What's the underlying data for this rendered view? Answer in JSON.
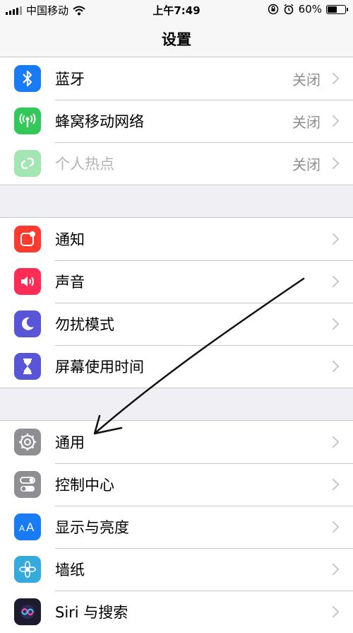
{
  "status": {
    "carrier": "中国移动",
    "time": "上午7:49",
    "battery_percent": "60%",
    "battery_level": 0.6
  },
  "nav": {
    "title": "设置"
  },
  "groups": [
    {
      "items": [
        {
          "label": "蓝牙",
          "value": "关闭",
          "icon": "bluetooth-icon",
          "color": "#1a7cf4"
        },
        {
          "label": "蜂窝移动网络",
          "value": "关闭",
          "icon": "cellular-icon",
          "color": "#34c759"
        },
        {
          "label": "个人热点",
          "value": "关闭",
          "icon": "hotspot-icon",
          "color": "#34c759",
          "disabled": true
        }
      ]
    },
    {
      "items": [
        {
          "label": "通知",
          "icon": "notifications-icon",
          "color": "#ff3b30"
        },
        {
          "label": "声音",
          "icon": "sound-icon",
          "color": "#ff2d55"
        },
        {
          "label": "勿扰模式",
          "icon": "moon-icon",
          "color": "#5856d6"
        },
        {
          "label": "屏幕使用时间",
          "icon": "hourglass-icon",
          "color": "#5856d6"
        }
      ]
    },
    {
      "items": [
        {
          "label": "通用",
          "icon": "gear-icon",
          "color": "#8e8e93"
        },
        {
          "label": "控制中心",
          "icon": "toggles-icon",
          "color": "#8e8e93"
        },
        {
          "label": "显示与亮度",
          "icon": "display-icon",
          "color": "#1a7cf4"
        },
        {
          "label": "墙纸",
          "icon": "wallpaper-flower-icon",
          "color": "#35aadc"
        },
        {
          "label": "Siri 与搜索",
          "icon": "siri-icon",
          "color": "#1c1c2e"
        }
      ]
    }
  ]
}
